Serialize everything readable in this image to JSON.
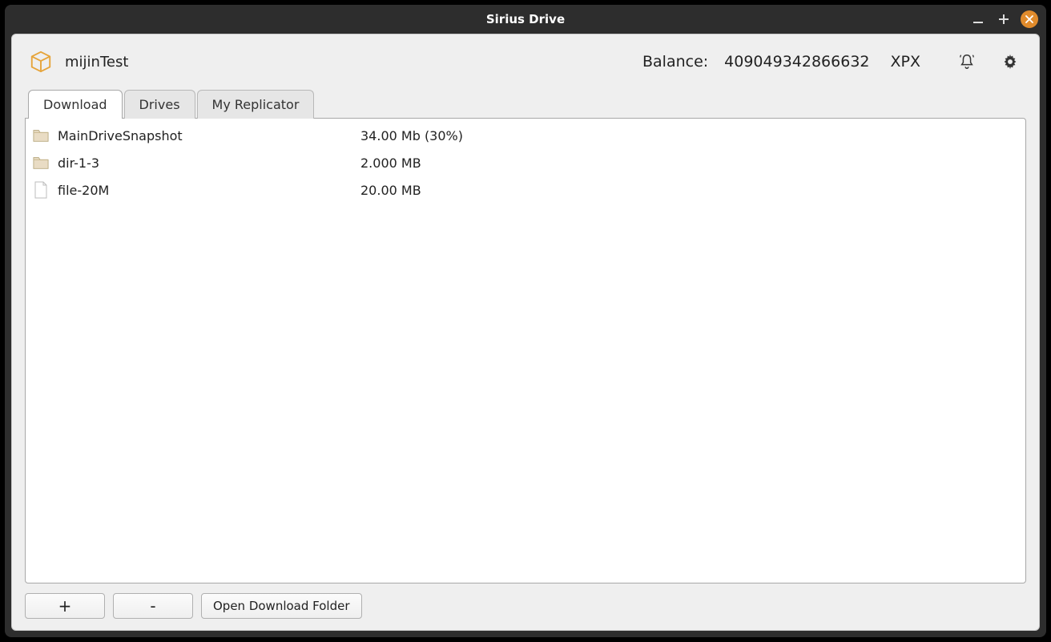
{
  "window": {
    "title": "Sirius Drive"
  },
  "header": {
    "app_name": "mijinTest",
    "balance_label": "Balance:",
    "balance_value": "409049342866632",
    "balance_unit": "XPX"
  },
  "tabs": {
    "download": "Download",
    "drives": "Drives",
    "replicator": "My Replicator",
    "active": "download"
  },
  "downloads": [
    {
      "icon": "folder",
      "name": "MainDriveSnapshot",
      "size": "34.00 Mb (30%)"
    },
    {
      "icon": "folder",
      "name": "dir-1-3",
      "size": "2.000 MB"
    },
    {
      "icon": "file",
      "name": "file-20M",
      "size": "20.00 MB"
    }
  ],
  "buttons": {
    "add": "+",
    "remove": "-",
    "open_folder": "Open Download Folder"
  }
}
